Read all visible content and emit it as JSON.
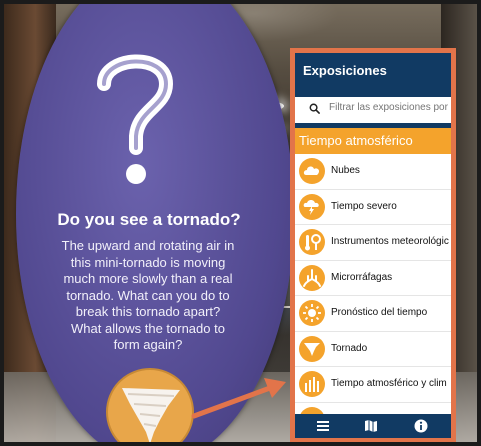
{
  "sign": {
    "title": "Do you see a tornado?",
    "body_lines": [
      "The upward and rotating air in",
      "this mini-tornado is moving",
      "much more slowly than a real",
      "tornado. What can you do to",
      "break this tornado apart?",
      "What allows the tornado to",
      "form again?"
    ]
  },
  "app": {
    "title": "Exposiciones",
    "search": {
      "placeholder": "Filtrar las exposiciones por"
    },
    "section_title": "Tiempo atmosférico",
    "items": [
      {
        "label": "Nubes",
        "icon": "cloud-icon"
      },
      {
        "label": "Tiempo severo",
        "icon": "storm-cloud-icon"
      },
      {
        "label": "Instrumentos meteorológic",
        "icon": "weather-instruments-icon"
      },
      {
        "label": "Microrráfagas",
        "icon": "microburst-icon"
      },
      {
        "label": "Pronóstico del tiempo",
        "icon": "sun-forecast-icon"
      },
      {
        "label": "Tornado",
        "icon": "tornado-icon"
      },
      {
        "label": "Tiempo atmosférico y clim",
        "icon": "climate-bars-icon"
      }
    ],
    "bottom_nav": [
      {
        "name": "menu-icon"
      },
      {
        "name": "map-icon"
      },
      {
        "name": "info-icon"
      }
    ],
    "colors": {
      "header": "#113a63",
      "accent": "#f4a32c",
      "frame": "#e2744a"
    }
  }
}
